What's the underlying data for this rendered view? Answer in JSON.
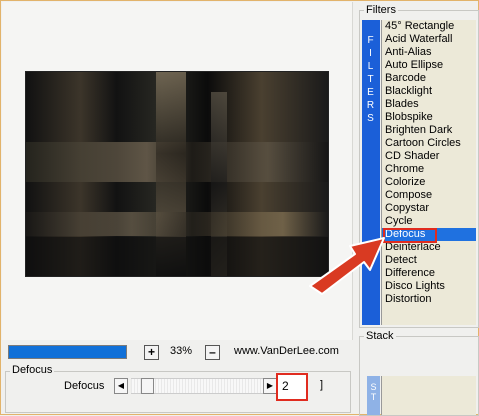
{
  "filters_group": {
    "label": "Filters",
    "vertical_label": [
      "F",
      "I",
      "L",
      "T",
      "E",
      "R",
      "S"
    ]
  },
  "filters_list": [
    "45° Rectangle",
    "Acid Waterfall",
    "Anti-Alias",
    "Auto Ellipse",
    "Barcode",
    "Blacklight",
    "Blades",
    "Blobspike",
    "Brighten Dark",
    "Cartoon Circles",
    "CD Shader",
    "Chrome",
    "Colorize",
    "Compose",
    "Copystar",
    "Cycle",
    "Defocus",
    "Deinterlace",
    "Detect",
    "Difference",
    "Disco Lights",
    "Distortion"
  ],
  "selected_filter": "Defocus",
  "stack_group": {
    "label": "Stack",
    "vertical_label": [
      "S",
      "T"
    ]
  },
  "zoom": {
    "plus": "+",
    "minus": "–",
    "value": "33%",
    "site": "www.VanDerLee.com",
    "progress": 1.0
  },
  "defocus_group": {
    "label": "Defocus",
    "param_label": "Defocus",
    "value": "2",
    "bracket": "]"
  },
  "colors": {
    "accent": "#1f71e0",
    "highlight": "#e02b1f",
    "arrow": "#d93a22"
  }
}
